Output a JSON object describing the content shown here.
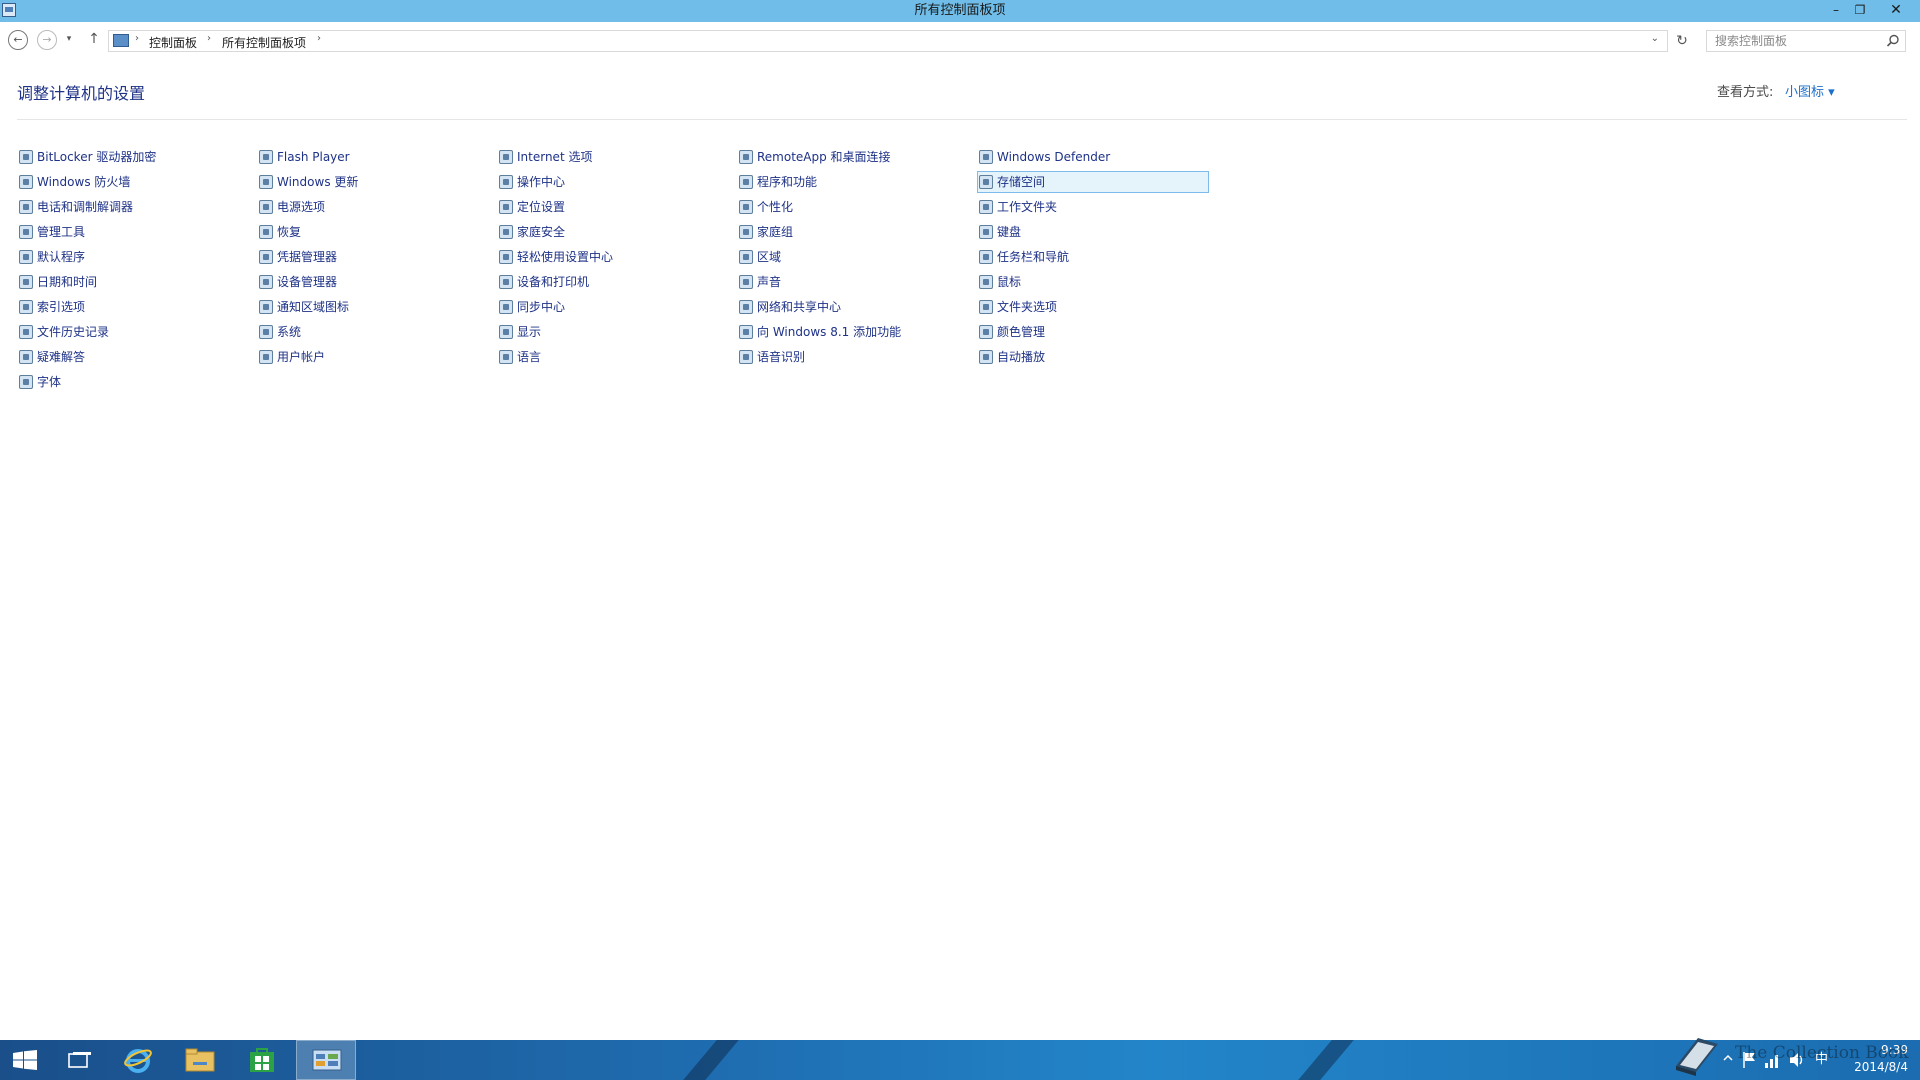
{
  "window": {
    "title": "所有控制面板项",
    "minimize": "–",
    "maximize": "❐",
    "close": "✕"
  },
  "nav": {
    "back": "←",
    "forward": "→",
    "recent": "▾",
    "up": "↑",
    "refresh": "↻",
    "breadcrumb_sep": "›",
    "breadcrumbs": [
      "控制面板",
      "所有控制面板项"
    ],
    "dropdown": "⌄",
    "search_placeholder": "搜索控制面板"
  },
  "header": {
    "title": "调整计算机的设置",
    "view_by_label": "查看方式:",
    "view_by_value": "小图标 ▾"
  },
  "columns": [
    [
      "BitLocker 驱动器加密",
      "Windows 防火墙",
      "电话和调制解调器",
      "管理工具",
      "默认程序",
      "日期和时间",
      "索引选项",
      "文件历史记录",
      "疑难解答",
      "字体"
    ],
    [
      "Flash Player",
      "Windows 更新",
      "电源选项",
      "恢复",
      "凭据管理器",
      "设备管理器",
      "通知区域图标",
      "系统",
      "用户帐户"
    ],
    [
      "Internet 选项",
      "操作中心",
      "定位设置",
      "家庭安全",
      "轻松使用设置中心",
      "设备和打印机",
      "同步中心",
      "显示",
      "语言"
    ],
    [
      "RemoteApp 和桌面连接",
      "程序和功能",
      "个性化",
      "家庭组",
      "区域",
      "声音",
      "网络和共享中心",
      "向 Windows 8.1 添加功能",
      "语音识别"
    ],
    [
      "Windows Defender",
      "存储空间",
      "工作文件夹",
      "键盘",
      "任务栏和导航",
      "鼠标",
      "文件夹选项",
      "颜色管理",
      "自动播放"
    ]
  ],
  "selected_item": "存储空间",
  "taskbar": {
    "clock_time": "9:39",
    "clock_date": "2014/8/4",
    "ime": "中"
  },
  "watermark": "The Collection Book",
  "colors": {
    "titlebar": "#6fbde8",
    "link": "#1e3287",
    "selection": "#e5f3fb",
    "taskbar": "#1f6fb3"
  }
}
